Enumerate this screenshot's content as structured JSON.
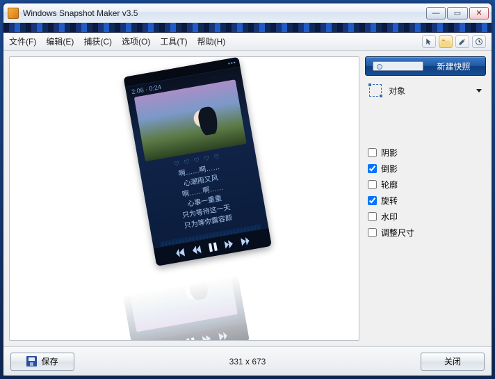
{
  "window": {
    "title": "Windows Snapshot Maker v3.5"
  },
  "menubar": {
    "items": [
      "文件(F)",
      "编辑(E)",
      "捕获(C)",
      "选项(O)",
      "工具(T)",
      "帮助(H)"
    ]
  },
  "sidebar": {
    "new_snapshot_label": "新建快照",
    "mode_label": "对象",
    "checks": [
      {
        "label": "阴影",
        "checked": false
      },
      {
        "label": "倒影",
        "checked": true
      },
      {
        "label": "轮廓",
        "checked": false
      },
      {
        "label": "旋转",
        "checked": true
      },
      {
        "label": "水印",
        "checked": false
      },
      {
        "label": "调整尺寸",
        "checked": false
      }
    ]
  },
  "bottombar": {
    "save_label": "保存",
    "close_label": "关闭",
    "dimensions": "331 x 673"
  },
  "player": {
    "time": "2:06 · 0:24",
    "hearts": "♡ ♡ ♡ ♡ ♡",
    "lyrics": [
      "啊……啊……",
      "心潮雨又风",
      "啊……啊……",
      "心事一重重",
      "只为等待这一天",
      "只为等你露容颜"
    ]
  }
}
